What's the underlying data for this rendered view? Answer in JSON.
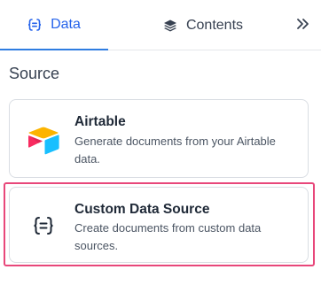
{
  "tabs": [
    {
      "label": "Data",
      "icon": "braces-list-icon",
      "active": true
    },
    {
      "label": "Contents",
      "icon": "layers-icon",
      "active": false
    }
  ],
  "collapse_icon": "double-chevron-right-icon",
  "section": {
    "title": "Source"
  },
  "sources": [
    {
      "title": "Airtable",
      "description": "Generate documents from your Airtable data.",
      "icon": "airtable-logo"
    },
    {
      "title": "Custom Data Source",
      "description": "Create documents from custom data sources.",
      "icon": "braces-list-icon",
      "highlighted": true
    }
  ],
  "colors": {
    "accent": "#2563eb",
    "highlight_border": "#e8477a",
    "airtable_yellow": "#fcb400",
    "airtable_red": "#f82b60",
    "airtable_blue": "#18bfff"
  }
}
